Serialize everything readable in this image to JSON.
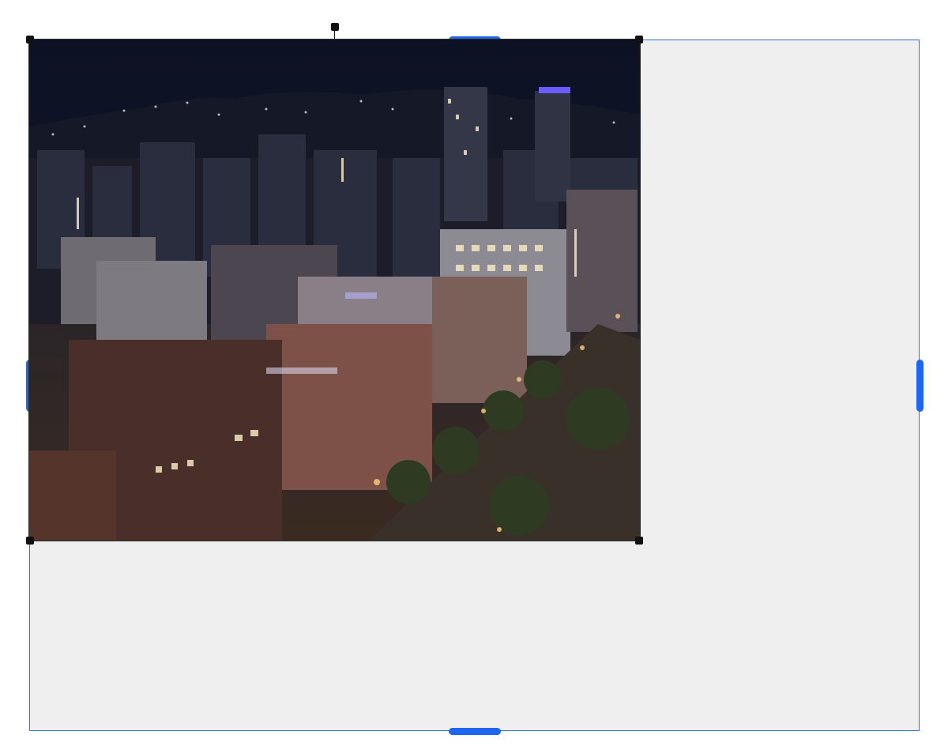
{
  "editor": {
    "image_description_hidden": "",
    "colors": {
      "accent": "#1f66ee",
      "canvas_bg": "#efefef",
      "handle": "#111111"
    }
  }
}
